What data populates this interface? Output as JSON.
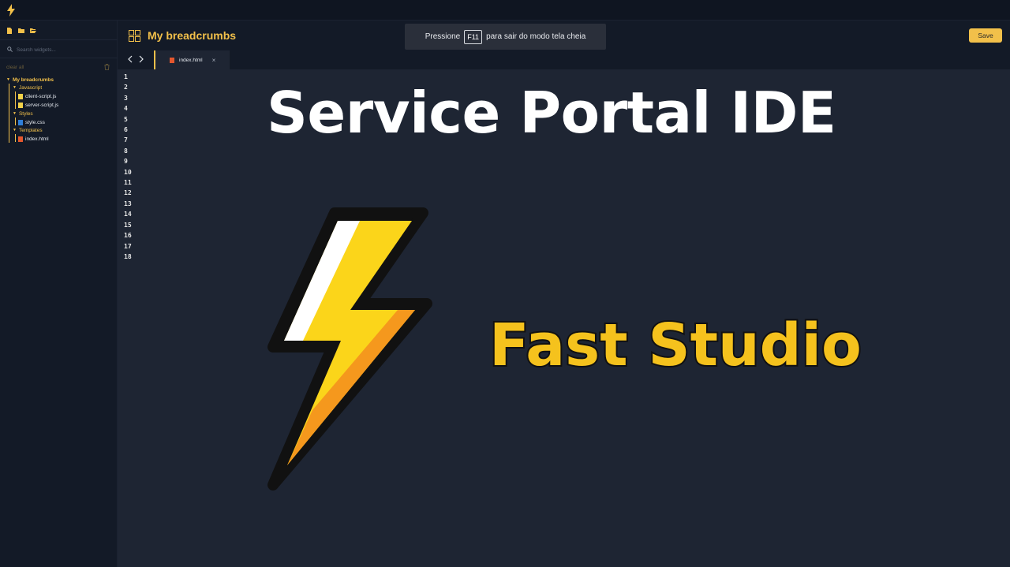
{
  "topbar": {
    "logo_icon": "bolt-icon"
  },
  "sidebar": {
    "actions": [
      {
        "icon": "new-file-icon"
      },
      {
        "icon": "save-folder-icon"
      },
      {
        "icon": "open-folder-icon"
      }
    ],
    "search_placeholder": "Search widgets...",
    "clear_all": "clear all",
    "tree": {
      "root": "My breadcrumbs",
      "javascript": "Javascript",
      "client_script": "client-script.js",
      "server_script": "server-script.js",
      "styles": "Styles",
      "style_css": "style.css",
      "templates": "Templates",
      "index_html": "index.html"
    }
  },
  "header": {
    "title": "My breadcrumbs",
    "f11_prefix": "Pressione",
    "f11_key": "F11",
    "f11_suffix": "para sair do modo tela cheia",
    "save_label": "Save"
  },
  "tabs": [
    {
      "label": "index.html",
      "close": "×"
    }
  ],
  "editor": {
    "line_numbers": [
      "1",
      "2",
      "3",
      "4",
      "5",
      "6",
      "7",
      "8",
      "9",
      "10",
      "11",
      "12",
      "13",
      "14",
      "15",
      "16",
      "17",
      "18"
    ]
  },
  "overlay": {
    "title": "Service Portal IDE",
    "subtitle": "Fast Studio"
  },
  "colors": {
    "accent": "#f2c04a",
    "background": "#1e2533",
    "panel": "#131a27"
  }
}
